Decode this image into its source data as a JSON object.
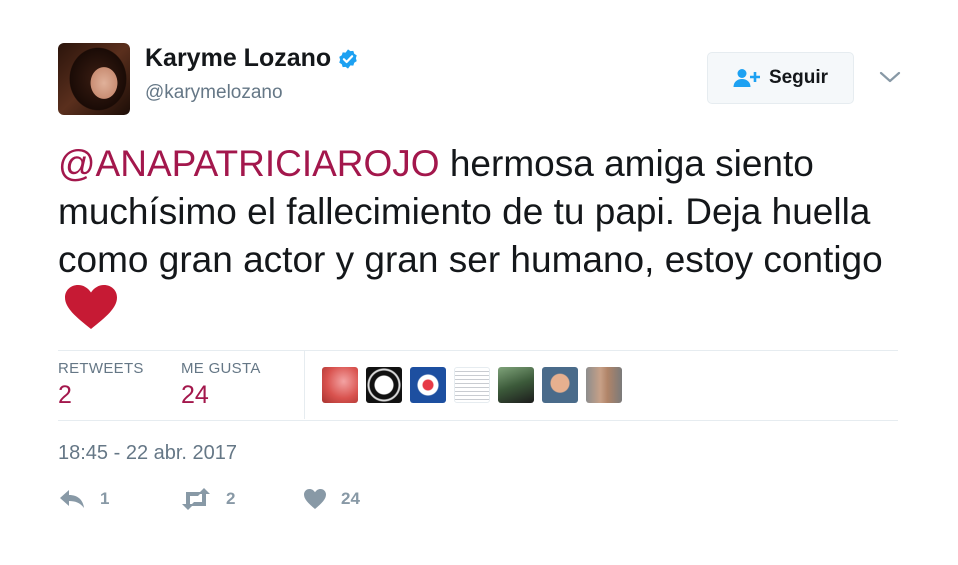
{
  "author": {
    "name": "Karyme Lozano",
    "handle": "@karymelozano",
    "verified_icon": "verified-badge-icon"
  },
  "follow": {
    "label": "Seguir",
    "icon": "add-user-icon"
  },
  "menu": {
    "icon": "chevron-down-icon"
  },
  "tweet": {
    "mention": "@ANAPATRICIAROJO",
    "text": " hermosa amiga siento muchísimo el fallecimiento de tu papi. Deja huella como gran actor y gran ser humano, estoy contigo ",
    "emoji": "heart-emoji"
  },
  "stats": {
    "retweets_label": "RETWEETS",
    "retweets_value": "2",
    "likes_label": "ME GUSTA",
    "likes_value": "24"
  },
  "liked_by_count": 7,
  "timestamp": "18:45 - 22 abr. 2017",
  "actions": {
    "reply_count": "1",
    "retweet_count": "2",
    "like_count": "24"
  },
  "colors": {
    "accent": "#a3174c",
    "muted": "#657786",
    "verified": "#1da1f2",
    "heart": "#c61a34"
  }
}
